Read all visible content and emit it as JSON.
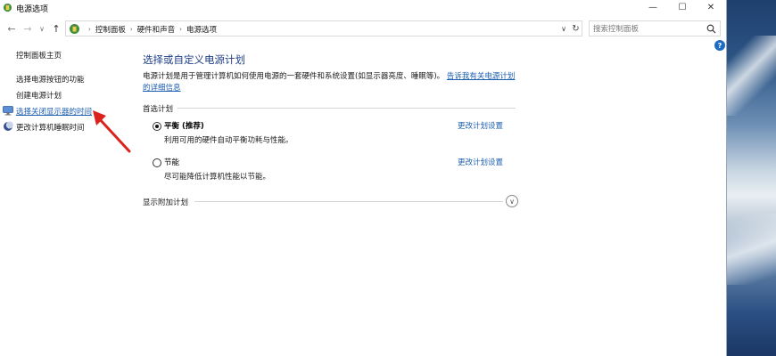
{
  "window": {
    "title": "电源选项",
    "min_glyph": "—",
    "max_glyph": "☐",
    "close_glyph": "✕"
  },
  "nav": {
    "back_glyph": "←",
    "forward_glyph": "→",
    "recent_glyph": "∨",
    "up_glyph": "↑"
  },
  "address": {
    "breadcrumbs": [
      "控制面板",
      "硬件和声音",
      "电源选项"
    ],
    "separator": "›",
    "dropdown_glyph": "∨",
    "refresh_glyph": "↻"
  },
  "search": {
    "placeholder": "搜索控制面板"
  },
  "help": {
    "glyph": "?"
  },
  "sidebar": {
    "home": "控制面板主页",
    "items": [
      "选择电源按钮的功能",
      "创建电源计划",
      "选择关闭显示器的时间",
      "更改计算机睡眠时间"
    ]
  },
  "main": {
    "title": "选择或自定义电源计划",
    "description": "电源计划是用于管理计算机如何使用电源的一套硬件和系统设置(如显示器亮度、睡眠等)。",
    "description_link": "告诉我有关电源计划的详细信息",
    "preferred_header": "首选计划",
    "plans": [
      {
        "name": "平衡 (推荐)",
        "description": "利用可用的硬件自动平衡功耗与性能。",
        "link": "更改计划设置",
        "selected": true
      },
      {
        "name": "节能",
        "description": "尽可能降低计算机性能以节能。",
        "link": "更改计划设置",
        "selected": false
      }
    ],
    "more_plans_header": "显示附加计划",
    "expand_glyph": "∨"
  },
  "colors": {
    "link": "#1c5fb0",
    "title": "#1e3e87",
    "annotation_arrow": "#d9231c"
  }
}
